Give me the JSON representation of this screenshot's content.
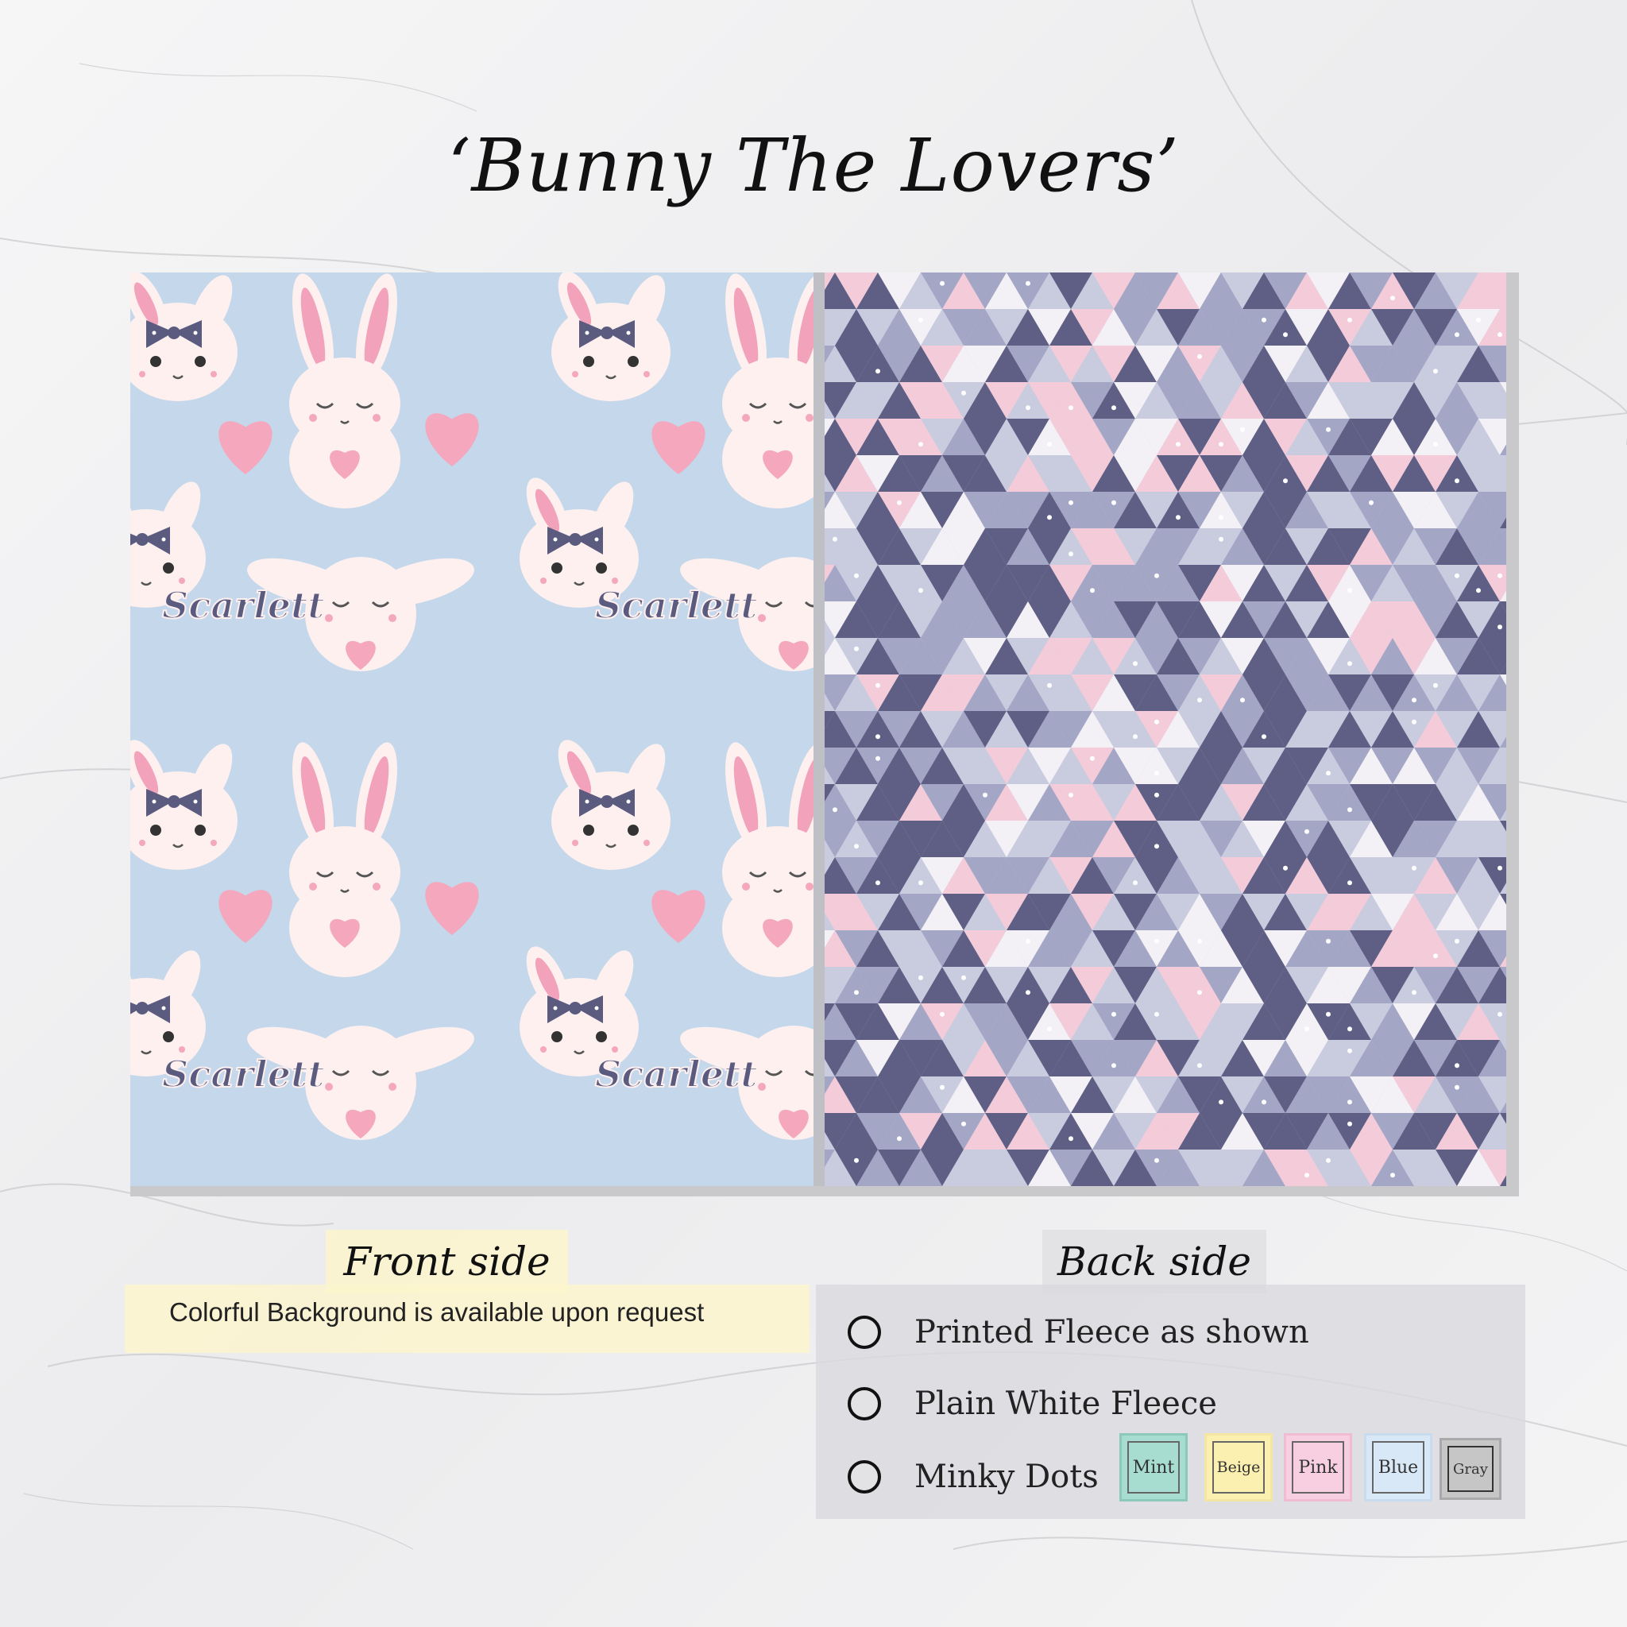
{
  "title": "‘Bunny The Lovers’",
  "front": {
    "tab_label": "Front side",
    "note": "Colorful Background is available upon request",
    "name_text": "Scarlett"
  },
  "back": {
    "tab_label": "Back side",
    "options": [
      {
        "label": "Printed Fleece as shown"
      },
      {
        "label": "Plain White Fleece"
      },
      {
        "label": "Minky Dots"
      }
    ],
    "swatches": [
      {
        "label": "Mint",
        "color": "#a7ddd0",
        "border": "#8cc9bb"
      },
      {
        "label": "Beige",
        "color": "#fbf0b0",
        "border": "#f3e6a2"
      },
      {
        "label": "Pink",
        "color": "#f8cfe0",
        "border": "#f0bcd2"
      },
      {
        "label": "Blue",
        "color": "#d9e8f7",
        "border": "#c9dbee"
      },
      {
        "label": "Gray",
        "color": "#c6c6c6",
        "border": "#a9a9a9"
      }
    ]
  },
  "colors": {
    "front_bg": "#c5d7ea",
    "bunny": "#fdf0ef",
    "heart": "#f4a7bd",
    "ear_inner": "#f2a3bb",
    "bow": "#5b5b80",
    "tri_dark": "#5f5f85",
    "tri_mid": "#a4a6c6",
    "tri_light": "#c9ccdf",
    "tri_pink": "#f4cbd9",
    "tri_white": "#f3f1f6"
  }
}
